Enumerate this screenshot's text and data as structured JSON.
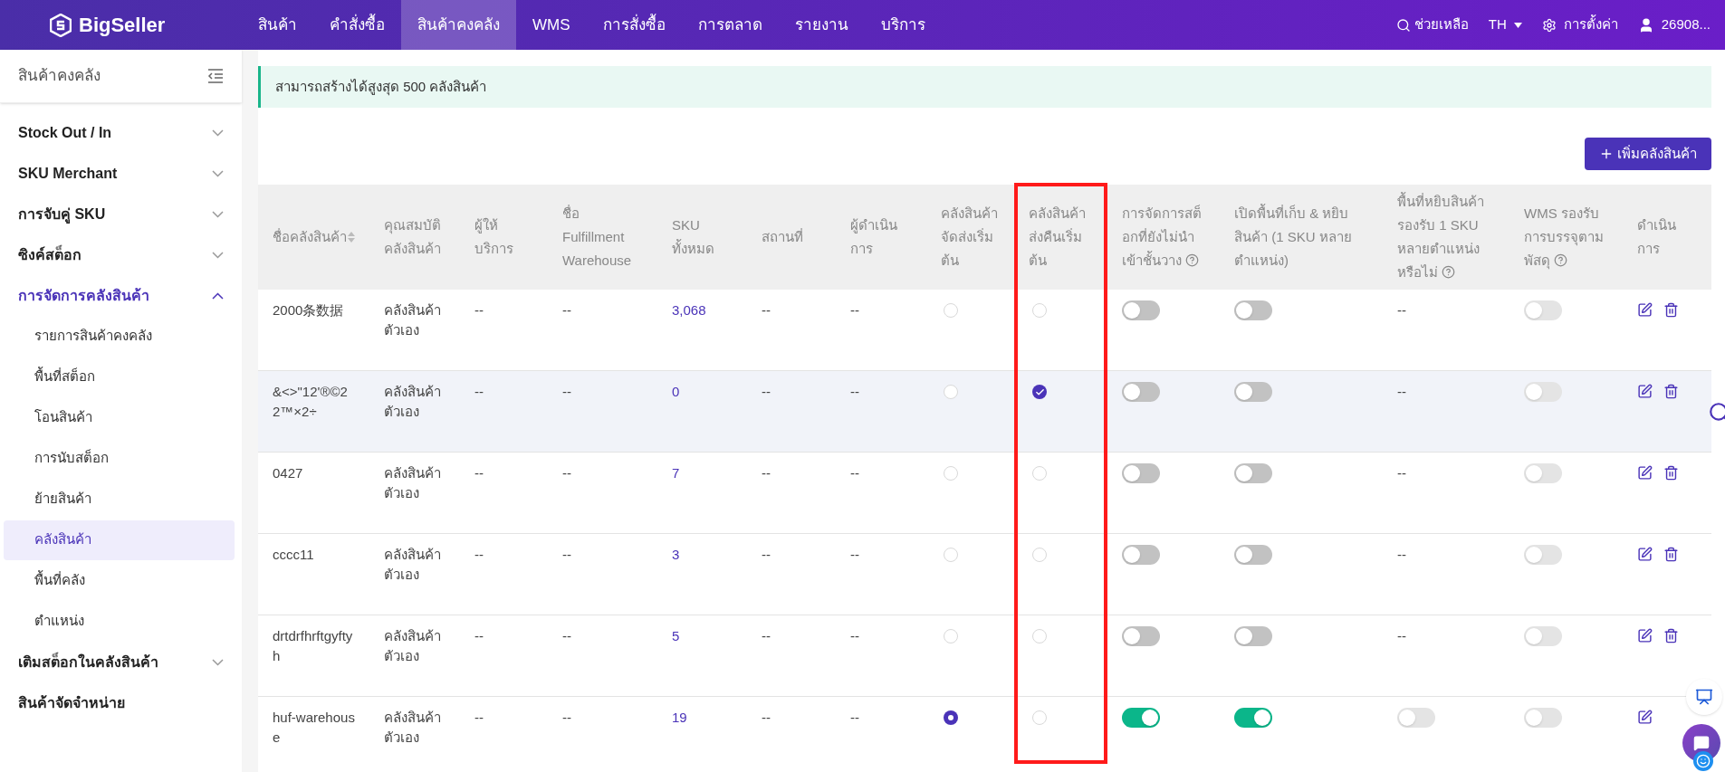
{
  "topbar": {
    "brand": "BigSeller",
    "nav": [
      {
        "label": "สินค้า",
        "selected": false
      },
      {
        "label": "คำสั่งซื้อ",
        "selected": false
      },
      {
        "label": "สินค้าคงคลัง",
        "selected": true
      },
      {
        "label": "WMS",
        "selected": false
      },
      {
        "label": "การสั่งซื้อ",
        "selected": false
      },
      {
        "label": "การตลาด",
        "selected": false
      },
      {
        "label": "รายงาน",
        "selected": false
      },
      {
        "label": "บริการ",
        "selected": false
      }
    ],
    "help": "ช่วยเหลือ",
    "language": "TH",
    "settings": "การตั้งค่า",
    "user": "26908..."
  },
  "sidebar": {
    "title": "สินค้าคงคลัง",
    "items": [
      {
        "label": "Stock Out / In",
        "expanded": false
      },
      {
        "label": "SKU Merchant",
        "expanded": false
      },
      {
        "label": "การจับคู่ SKU",
        "expanded": false
      },
      {
        "label": "ซิงค์สต็อก",
        "expanded": false
      },
      {
        "label": "การจัดการคลังสินค้า",
        "expanded": true,
        "children": [
          {
            "label": "รายการสินค้าคงคลัง",
            "selected": false
          },
          {
            "label": "พื้นที่สต็อก",
            "selected": false
          },
          {
            "label": "โอนสินค้า",
            "selected": false
          },
          {
            "label": "การนับสต็อก",
            "selected": false
          },
          {
            "label": "ย้ายสินค้า",
            "selected": false
          },
          {
            "label": "คลังสินค้า",
            "selected": true
          },
          {
            "label": "พื้นที่คลัง",
            "selected": false
          },
          {
            "label": "ตำแหน่ง",
            "selected": false
          }
        ]
      },
      {
        "label": "เติมสต็อกในคลังสินค้า",
        "expanded": false
      },
      {
        "label": "สินค้าจัดจำหน่าย"
      }
    ]
  },
  "notice": "สามารถสร้างได้สูงสุด 500 คลังสินค้า",
  "add_button": "เพิ่มคลังสินค้า",
  "table": {
    "columns": [
      {
        "label": "ชื่อคลังสินค้า",
        "sortable": true,
        "help": false,
        "highlighted": false
      },
      {
        "label": "คุณสมบัติคลังสินค้า",
        "sortable": false,
        "help": false,
        "highlighted": false
      },
      {
        "label": "ผู้ให้บริการ",
        "sortable": false,
        "help": false,
        "highlighted": false
      },
      {
        "label": "ชื่อ Fulfillment Warehouse",
        "sortable": false,
        "help": false,
        "highlighted": false
      },
      {
        "label": "SKU ทั้งหมด",
        "sortable": false,
        "help": false,
        "highlighted": false
      },
      {
        "label": "สถานที่",
        "sortable": false,
        "help": false,
        "highlighted": false
      },
      {
        "label": "ผู้ดำเนินการ",
        "sortable": false,
        "help": false,
        "highlighted": false
      },
      {
        "label": "คลังสินค้าจัดส่งเริ่มต้น",
        "sortable": false,
        "help": false,
        "highlighted": false
      },
      {
        "label": "คลังสินค้าส่งคืนเริ่มต้น",
        "sortable": false,
        "help": false,
        "highlighted": true
      },
      {
        "label": "การจัดการสต็อกที่ยังไม่นำเข้าชั้นวาง",
        "sortable": false,
        "help": true,
        "highlighted": false
      },
      {
        "label": "เปิดพื้นที่เก็บ & หยิบสินค้า (1 SKU หลายตำแหน่ง)",
        "sortable": false,
        "help": false,
        "highlighted": false
      },
      {
        "label": "พื้นที่หยิบสินค้ารองรับ 1 SKU หลายตำแหน่งหรือไม่",
        "sortable": false,
        "help": true,
        "highlighted": false
      },
      {
        "label": "WMS รองรับการบรรจุตามพัสดุ",
        "sortable": false,
        "help": true,
        "highlighted": false
      },
      {
        "label": "ดำเนินการ",
        "sortable": false,
        "help": false,
        "highlighted": false
      }
    ],
    "rows": [
      {
        "hovered": false,
        "name": "2000条数据",
        "attribute": "คลังสินค้าตัวเอง",
        "provider": "--",
        "fulfillment": "--",
        "sku_total": "3,068",
        "location": "--",
        "operator": "--",
        "default_outbound": {
          "selected": false
        },
        "default_return": {
          "selected": false
        },
        "unshelved_stock": {
          "on": false,
          "disabled": false
        },
        "pick_area": {
          "on": false,
          "disabled": false
        },
        "multi_location": {
          "kind": "text",
          "text": "--"
        },
        "wms_packing": {
          "on": false,
          "disabled": true
        },
        "show_delete": true
      },
      {
        "hovered": true,
        "name": "&<>\"12'®©22™×2÷",
        "attribute": "คลังสินค้าตัวเอง",
        "provider": "--",
        "fulfillment": "--",
        "sku_total": "0",
        "location": "--",
        "operator": "--",
        "default_outbound": {
          "selected": false
        },
        "default_return": {
          "selected": true
        },
        "unshelved_stock": {
          "on": false,
          "disabled": false
        },
        "pick_area": {
          "on": false,
          "disabled": false
        },
        "multi_location": {
          "kind": "text",
          "text": "--"
        },
        "wms_packing": {
          "on": false,
          "disabled": true
        },
        "show_delete": true
      },
      {
        "hovered": false,
        "name": "0427",
        "attribute": "คลังสินค้าตัวเอง",
        "provider": "--",
        "fulfillment": "--",
        "sku_total": "7",
        "location": "--",
        "operator": "--",
        "default_outbound": {
          "selected": false
        },
        "default_return": {
          "selected": false
        },
        "unshelved_stock": {
          "on": false,
          "disabled": false
        },
        "pick_area": {
          "on": false,
          "disabled": false
        },
        "multi_location": {
          "kind": "text",
          "text": "--"
        },
        "wms_packing": {
          "on": false,
          "disabled": true
        },
        "show_delete": true
      },
      {
        "hovered": false,
        "name": "cccc11",
        "attribute": "คลังสินค้าตัวเอง",
        "provider": "--",
        "fulfillment": "--",
        "sku_total": "3",
        "location": "--",
        "operator": "--",
        "default_outbound": {
          "selected": false
        },
        "default_return": {
          "selected": false
        },
        "unshelved_stock": {
          "on": false,
          "disabled": false
        },
        "pick_area": {
          "on": false,
          "disabled": false
        },
        "multi_location": {
          "kind": "text",
          "text": "--"
        },
        "wms_packing": {
          "on": false,
          "disabled": true
        },
        "show_delete": true
      },
      {
        "hovered": false,
        "name": "drtdrfhrftgyftyh",
        "attribute": "คลังสินค้าตัวเอง",
        "provider": "--",
        "fulfillment": "--",
        "sku_total": "5",
        "location": "--",
        "operator": "--",
        "default_outbound": {
          "selected": false
        },
        "default_return": {
          "selected": false
        },
        "unshelved_stock": {
          "on": false,
          "disabled": false
        },
        "pick_area": {
          "on": false,
          "disabled": false
        },
        "multi_location": {
          "kind": "text",
          "text": "--"
        },
        "wms_packing": {
          "on": false,
          "disabled": true
        },
        "show_delete": true
      },
      {
        "hovered": false,
        "name": "huf-warehouse",
        "attribute": "คลังสินค้าตัวเอง",
        "provider": "--",
        "fulfillment": "--",
        "sku_total": "19",
        "location": "--",
        "operator": "--",
        "default_outbound": {
          "selected": true
        },
        "default_return": {
          "selected": false
        },
        "unshelved_stock": {
          "on": true,
          "disabled": false
        },
        "pick_area": {
          "on": true,
          "disabled": false
        },
        "multi_location": {
          "kind": "toggle",
          "on": false,
          "disabled": true
        },
        "wms_packing": {
          "on": false,
          "disabled": true
        },
        "show_delete": false
      }
    ]
  }
}
